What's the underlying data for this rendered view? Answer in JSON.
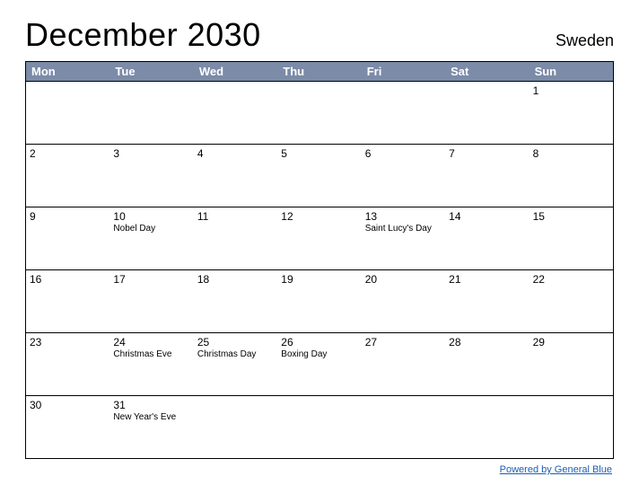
{
  "header": {
    "title": "December 2030",
    "region": "Sweden"
  },
  "day_labels": [
    "Mon",
    "Tue",
    "Wed",
    "Thu",
    "Fri",
    "Sat",
    "Sun"
  ],
  "weeks": [
    [
      {
        "day": "",
        "event": ""
      },
      {
        "day": "",
        "event": ""
      },
      {
        "day": "",
        "event": ""
      },
      {
        "day": "",
        "event": ""
      },
      {
        "day": "",
        "event": ""
      },
      {
        "day": "",
        "event": ""
      },
      {
        "day": "1",
        "event": ""
      }
    ],
    [
      {
        "day": "2",
        "event": ""
      },
      {
        "day": "3",
        "event": ""
      },
      {
        "day": "4",
        "event": ""
      },
      {
        "day": "5",
        "event": ""
      },
      {
        "day": "6",
        "event": ""
      },
      {
        "day": "7",
        "event": ""
      },
      {
        "day": "8",
        "event": ""
      }
    ],
    [
      {
        "day": "9",
        "event": ""
      },
      {
        "day": "10",
        "event": "Nobel Day"
      },
      {
        "day": "11",
        "event": ""
      },
      {
        "day": "12",
        "event": ""
      },
      {
        "day": "13",
        "event": "Saint Lucy's Day"
      },
      {
        "day": "14",
        "event": ""
      },
      {
        "day": "15",
        "event": ""
      }
    ],
    [
      {
        "day": "16",
        "event": ""
      },
      {
        "day": "17",
        "event": ""
      },
      {
        "day": "18",
        "event": ""
      },
      {
        "day": "19",
        "event": ""
      },
      {
        "day": "20",
        "event": ""
      },
      {
        "day": "21",
        "event": ""
      },
      {
        "day": "22",
        "event": ""
      }
    ],
    [
      {
        "day": "23",
        "event": ""
      },
      {
        "day": "24",
        "event": "Christmas Eve"
      },
      {
        "day": "25",
        "event": "Christmas Day"
      },
      {
        "day": "26",
        "event": "Boxing Day"
      },
      {
        "day": "27",
        "event": ""
      },
      {
        "day": "28",
        "event": ""
      },
      {
        "day": "29",
        "event": ""
      }
    ],
    [
      {
        "day": "30",
        "event": ""
      },
      {
        "day": "31",
        "event": "New Year's Eve"
      },
      {
        "day": "",
        "event": ""
      },
      {
        "day": "",
        "event": ""
      },
      {
        "day": "",
        "event": ""
      },
      {
        "day": "",
        "event": ""
      },
      {
        "day": "",
        "event": ""
      }
    ]
  ],
  "footer": {
    "label": "Powered by General Blue"
  }
}
